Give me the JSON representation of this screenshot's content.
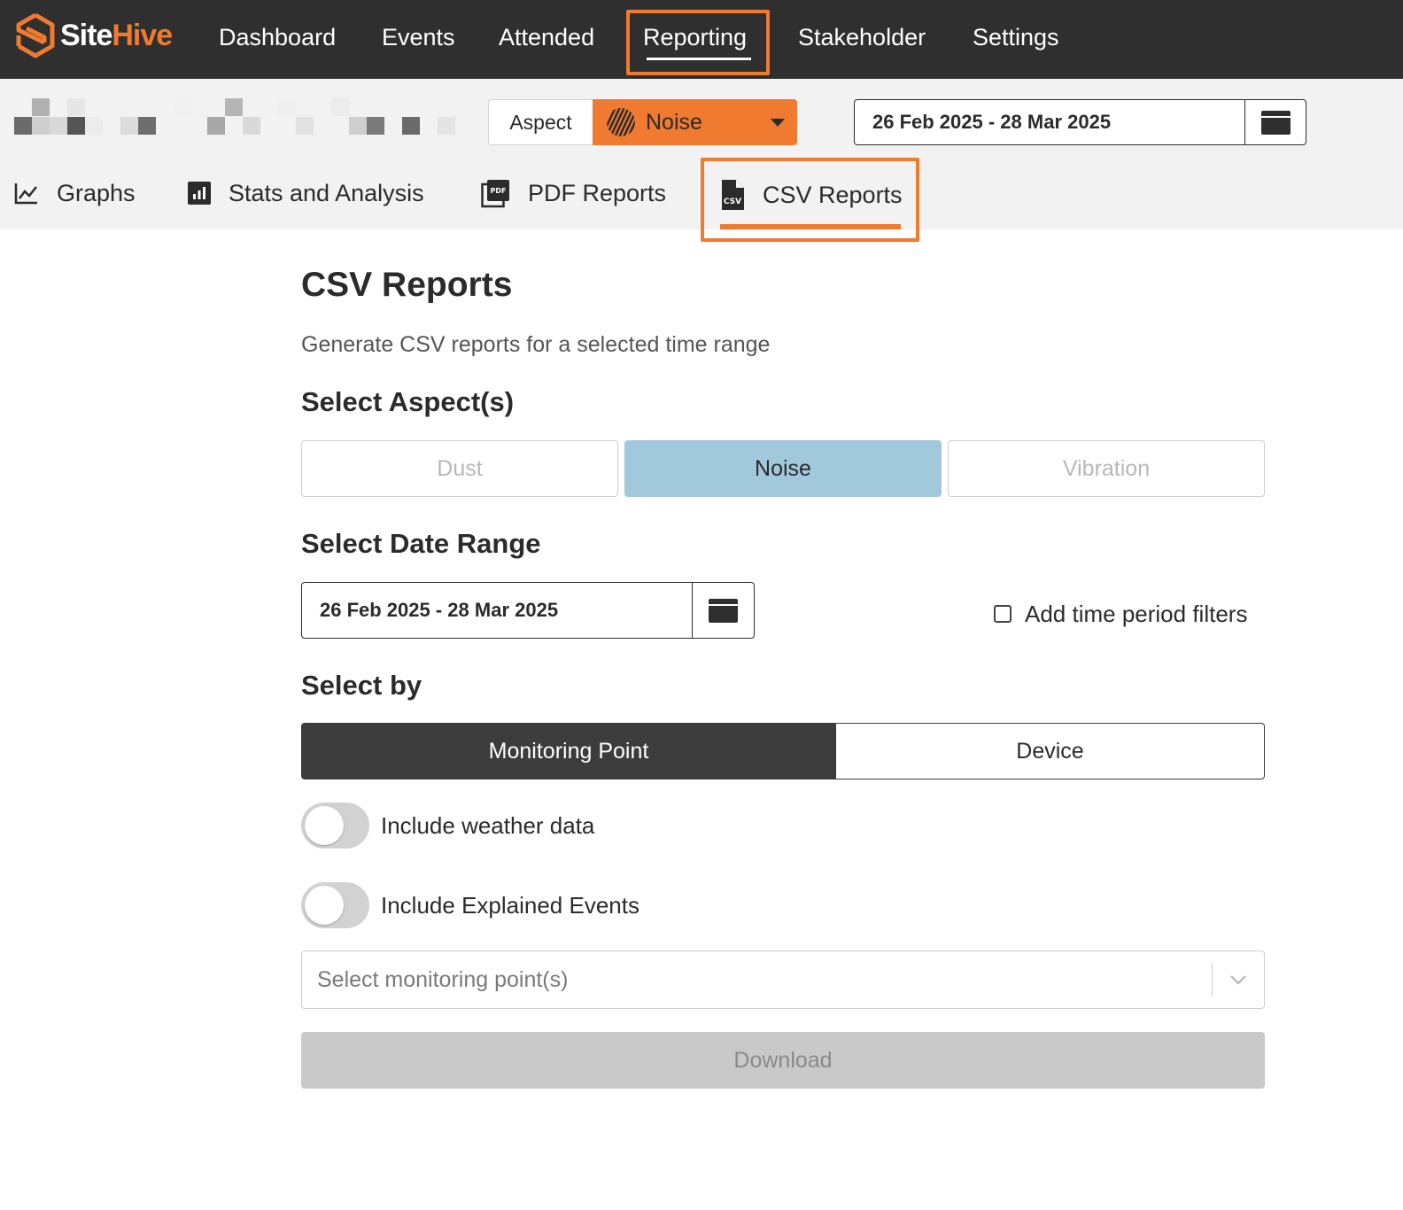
{
  "app": {
    "brand_part1": "Site",
    "brand_part2": "Hive",
    "accent": "#ef7a30",
    "logo_icon": "sitehive-hexagon-logo"
  },
  "nav": {
    "items": [
      {
        "label": "Dashboard"
      },
      {
        "label": "Events"
      },
      {
        "label": "Attended"
      },
      {
        "label": "Reporting",
        "active": true
      },
      {
        "label": "Stakeholder"
      },
      {
        "label": "Settings"
      }
    ]
  },
  "toolbar": {
    "aspect_label": "Aspect",
    "aspect_value": "Noise",
    "aspect_icon": "noise-stripes-icon",
    "date_range": "26 Feb 2025 - 28 Mar 2025",
    "calendar_icon": "calendar-icon"
  },
  "tabs": [
    {
      "label": "Graphs",
      "icon": "line-chart-icon"
    },
    {
      "label": "Stats and Analysis",
      "icon": "bar-chart-icon"
    },
    {
      "label": "PDF Reports",
      "icon": "pdf-file-icon"
    },
    {
      "label": "CSV Reports",
      "icon": "csv-file-icon",
      "active": true
    }
  ],
  "main": {
    "title": "CSV Reports",
    "description": "Generate CSV reports for a selected time range",
    "aspects_heading": "Select Aspect(s)",
    "aspects": [
      {
        "label": "Dust",
        "selected": false
      },
      {
        "label": "Noise",
        "selected": true
      },
      {
        "label": "Vibration",
        "selected": false
      }
    ],
    "date_heading": "Select Date Range",
    "date_range": "26 Feb 2025 - 28 Mar 2025",
    "time_filter_label": "Add time period filters",
    "time_filter_checked": false,
    "select_by_heading": "Select by",
    "select_by": [
      {
        "label": "Monitoring Point",
        "selected": true
      },
      {
        "label": "Device",
        "selected": false
      }
    ],
    "weather_toggle_label": "Include weather data",
    "weather_toggle_on": false,
    "events_toggle_label": "Include Explained Events",
    "events_toggle_on": false,
    "monitoring_placeholder": "Select monitoring point(s)",
    "download_label": "Download"
  }
}
